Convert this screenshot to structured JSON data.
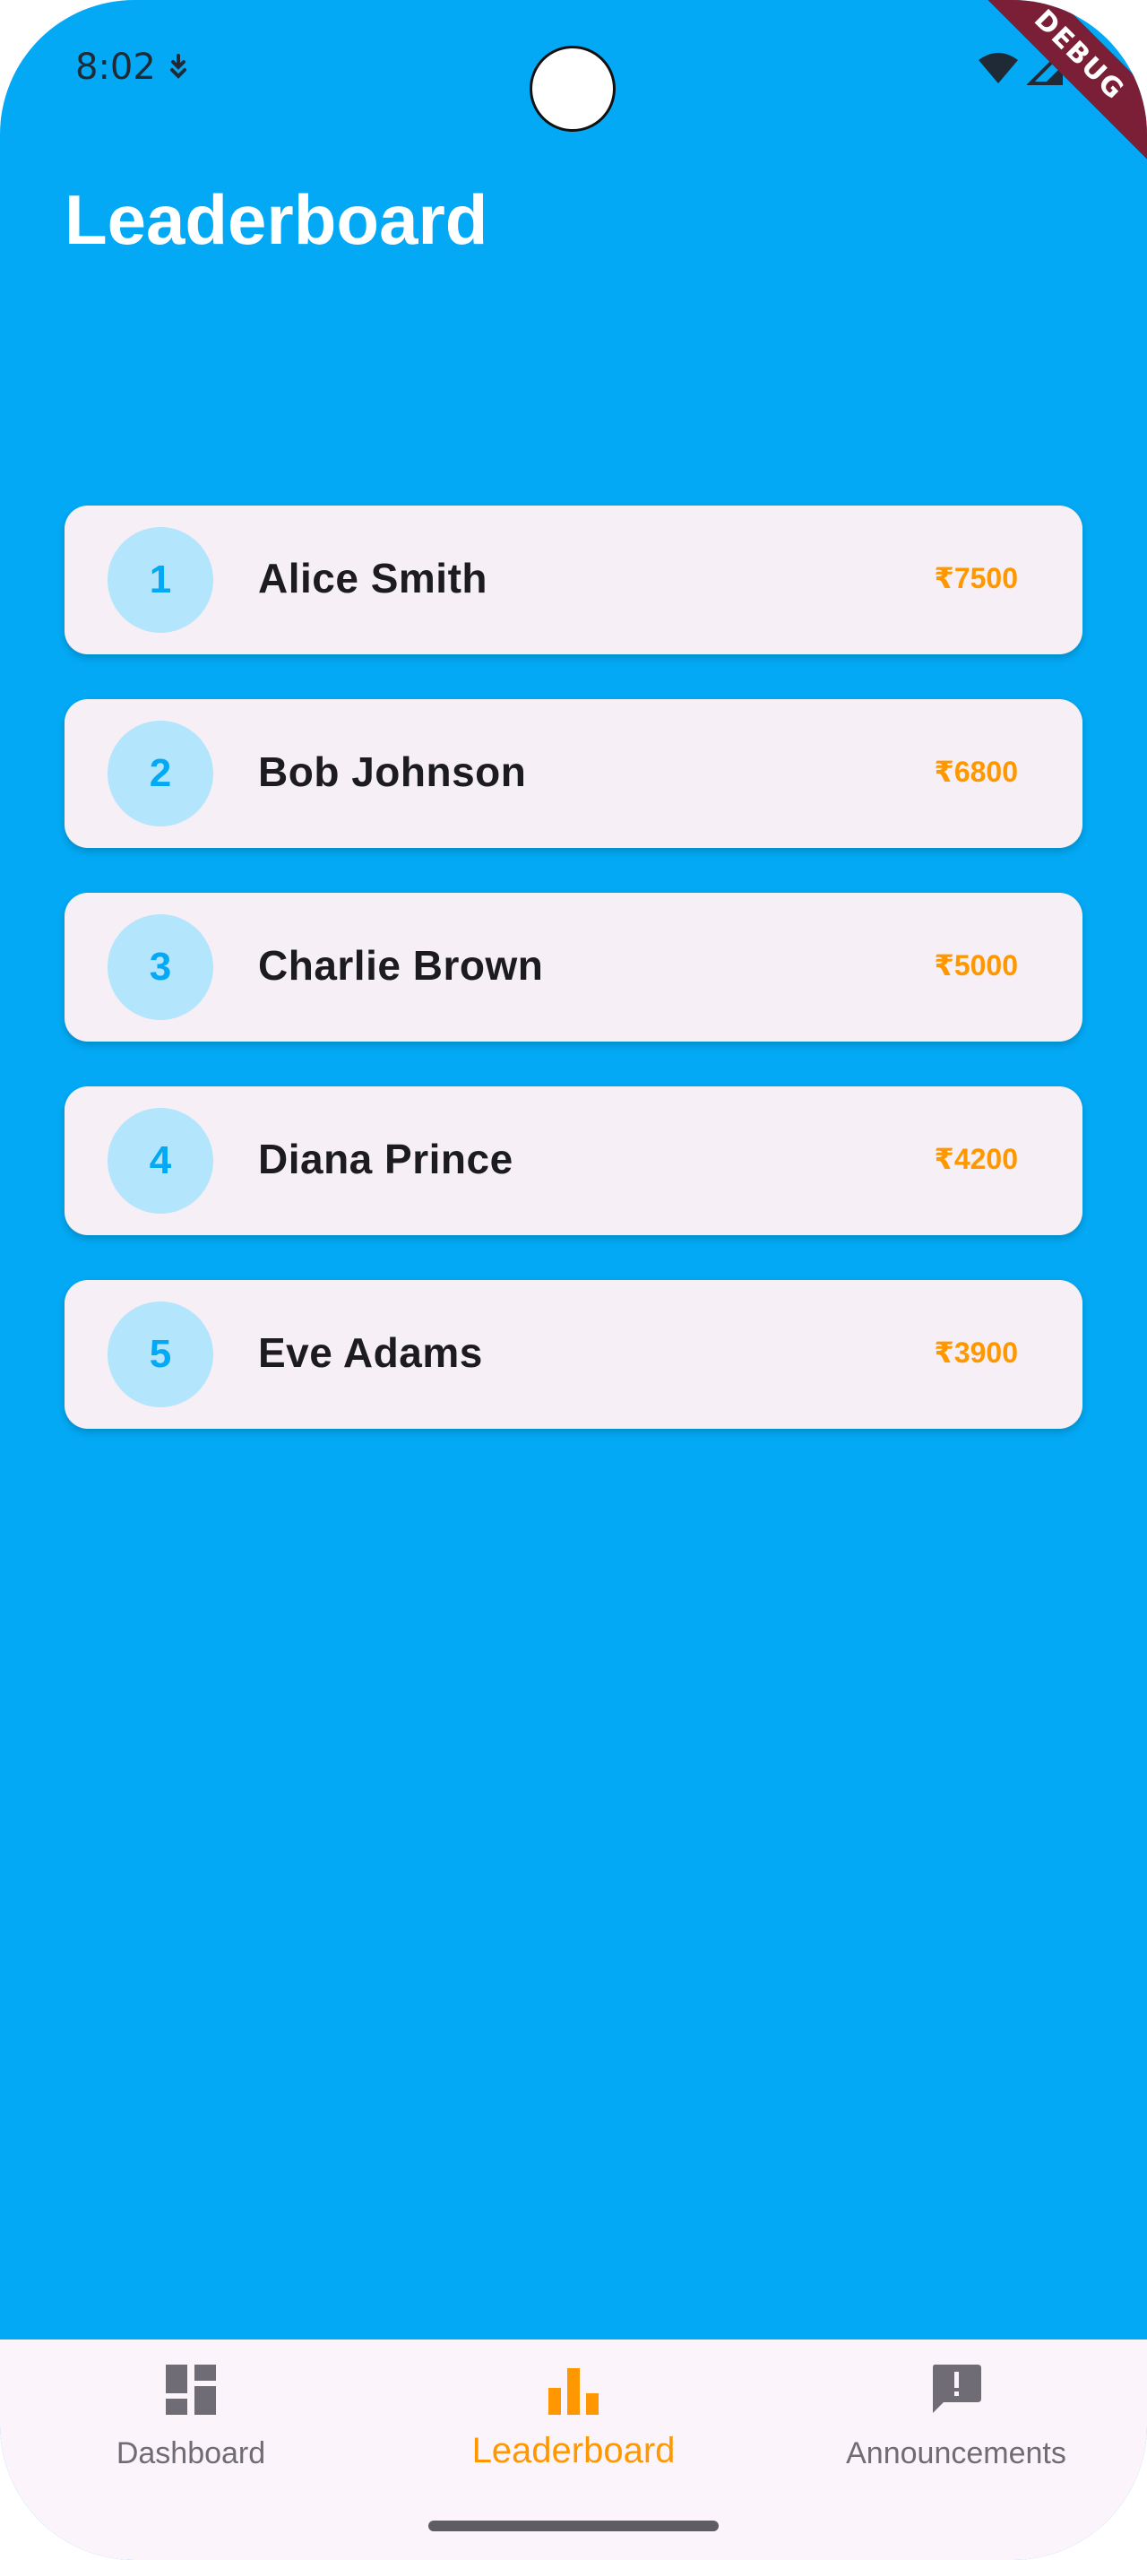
{
  "status_bar": {
    "time": "8:02",
    "left_icon": "download-indicator-icon",
    "right_icons": [
      "wifi-icon",
      "cellular-signal-icon",
      "battery-icon"
    ]
  },
  "debug_banner": "DEBUG",
  "header": {
    "title": "Leaderboard"
  },
  "leaderboard": {
    "entries": [
      {
        "rank": "1",
        "name": "Alice Smith",
        "amount": "₹7500"
      },
      {
        "rank": "2",
        "name": "Bob Johnson",
        "amount": "₹6800"
      },
      {
        "rank": "3",
        "name": "Charlie Brown",
        "amount": "₹5000"
      },
      {
        "rank": "4",
        "name": "Diana Prince",
        "amount": "₹4200"
      },
      {
        "rank": "5",
        "name": "Eve Adams",
        "amount": "₹3900"
      }
    ]
  },
  "bottom_nav": {
    "items": [
      {
        "label": "Dashboard",
        "icon": "dashboard-icon",
        "active": false
      },
      {
        "label": "Leaderboard",
        "icon": "bar-chart-icon",
        "active": true
      },
      {
        "label": "Announcements",
        "icon": "announcement-icon",
        "active": false
      }
    ]
  },
  "colors": {
    "background": "#03A9F4",
    "card": "#F6EFF5",
    "rank_circle": "#B3E5FC",
    "accent": "#FF9800",
    "nav_background": "#FCF4FB"
  }
}
